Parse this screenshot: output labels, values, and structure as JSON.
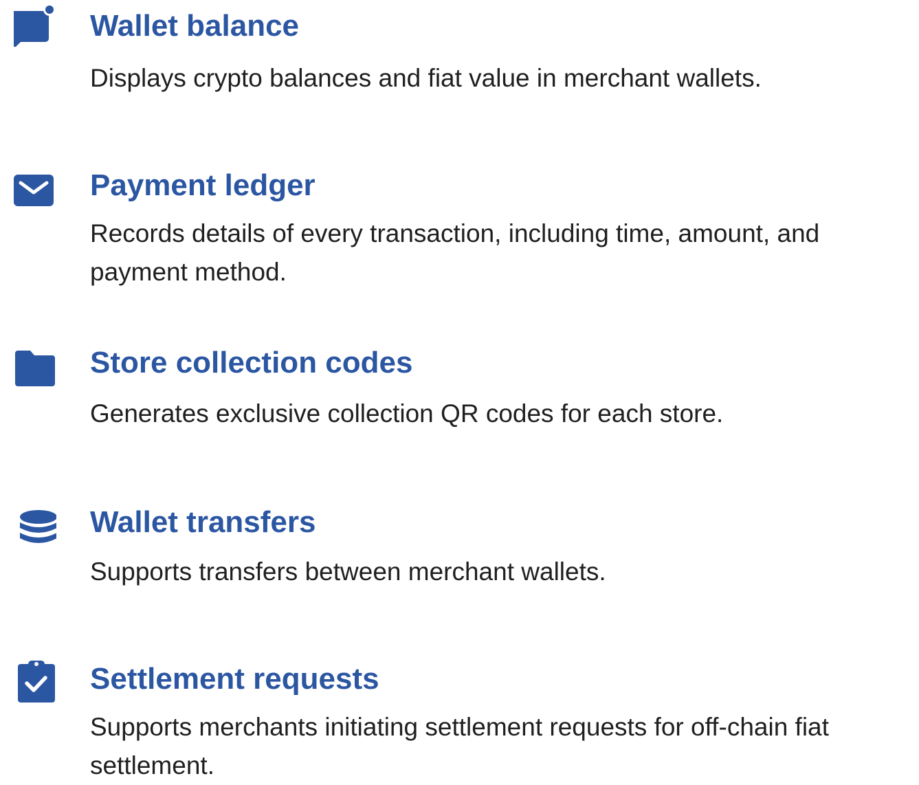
{
  "colors": {
    "accent": "#2B56A2",
    "text": "#1f1f1f",
    "background": "#ffffff"
  },
  "features": [
    {
      "icon": "chat-bubble-notification-icon",
      "title": "Wallet balance",
      "description": "Displays crypto balances and fiat value in merchant wallets."
    },
    {
      "icon": "envelope-icon",
      "title": "Payment ledger",
      "description": "Records details of every transaction, including time, amount, and payment method."
    },
    {
      "icon": "folder-icon",
      "title": "Store collection codes",
      "description": "Generates exclusive collection QR codes for each store."
    },
    {
      "icon": "database-icon",
      "title": "Wallet transfers",
      "description": "Supports transfers between merchant wallets."
    },
    {
      "icon": "clipboard-check-icon",
      "title": "Settlement requests",
      "description": "Supports merchants initiating settlement requests for off-chain fiat settlement."
    }
  ]
}
